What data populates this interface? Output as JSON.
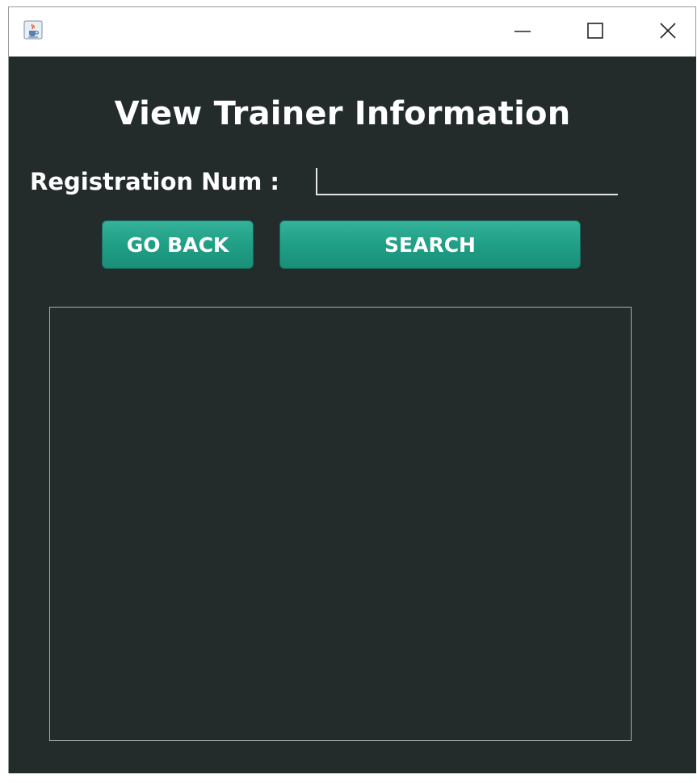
{
  "window": {
    "icon": "java-cup-icon",
    "controls": {
      "minimize": "minimize-icon",
      "maximize": "maximize-icon",
      "close": "close-icon"
    }
  },
  "form": {
    "title": "View Trainer Information",
    "registration_label": "Registration Num :",
    "registration_value": "",
    "go_back_label": "GO BACK",
    "search_label": "SEARCH"
  },
  "result_area": {
    "content": ""
  },
  "colors": {
    "background": "#232b2b",
    "button": "#21a187",
    "text": "#ffffff"
  }
}
